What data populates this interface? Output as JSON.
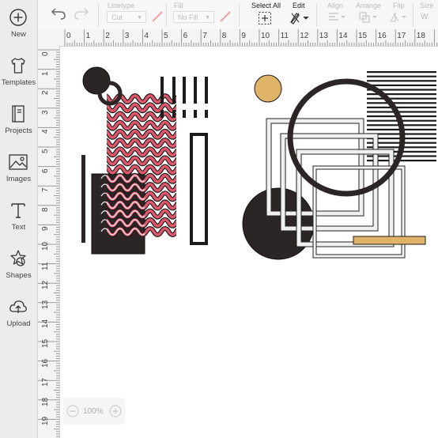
{
  "sidebar": {
    "items": [
      {
        "label": "New",
        "icon": "plus-circle-icon"
      },
      {
        "label": "Templates",
        "icon": "shirt-icon"
      },
      {
        "label": "Projects",
        "icon": "book-icon"
      },
      {
        "label": "Images",
        "icon": "image-icon"
      },
      {
        "label": "Text",
        "icon": "text-icon"
      },
      {
        "label": "Shapes",
        "icon": "shapes-icon"
      },
      {
        "label": "Upload",
        "icon": "cloud-upload-icon"
      }
    ]
  },
  "toolbar": {
    "linetype_label": "Linetype",
    "linetype_value": "Cut",
    "fill_label": "Fill",
    "fill_value": "No Fill",
    "select_all_label": "Select All",
    "edit_label": "Edit",
    "align_label": "Align",
    "arrange_label": "Arrange",
    "flip_label": "Flip",
    "size_label": "Size",
    "size_w": "W"
  },
  "ruler": {
    "top": [
      "0",
      "1",
      "2",
      "3",
      "4",
      "5",
      "6",
      "7",
      "8",
      "9",
      "10",
      "11",
      "12",
      "13",
      "14",
      "15",
      "16",
      "17",
      "18"
    ],
    "left": [
      "0",
      "1",
      "2",
      "3",
      "4",
      "5",
      "6",
      "7",
      "8",
      "9",
      "10",
      "11",
      "12",
      "13",
      "14",
      "15",
      "16",
      "17",
      "18",
      "19"
    ]
  },
  "zoom": {
    "value": "100%"
  },
  "colors": {
    "dark": "#2b2526",
    "red": "#e0566a",
    "gold": "#e0b468",
    "outline": "#1c1c1c"
  }
}
